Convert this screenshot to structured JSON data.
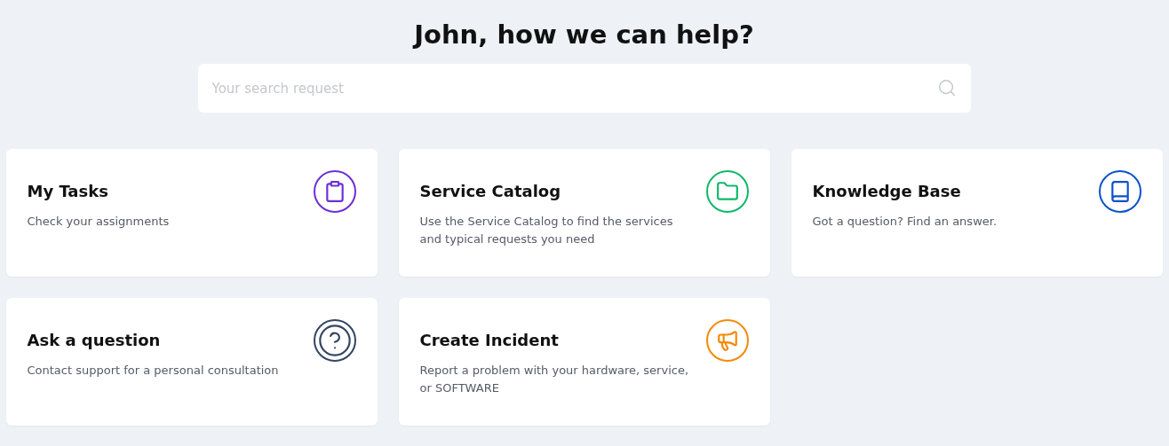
{
  "heading": "John, how we can help?",
  "search": {
    "placeholder": "Your search request"
  },
  "cards": [
    {
      "title": "My Tasks",
      "description": "Check your assignments",
      "kind": "clipboard",
      "color": "#6d2fd6"
    },
    {
      "title": "Service Catalog",
      "description": "Use the Service Catalog to find the services and typical requests you need",
      "kind": "folder",
      "color": "#12b76a"
    },
    {
      "title": "Knowledge Base",
      "description": "Got a question? Find an answer.",
      "kind": "book",
      "color": "#0b52c9"
    },
    {
      "title": "Ask a question",
      "description": "Contact support for a personal consultation",
      "kind": "question",
      "color": "#334563"
    },
    {
      "title": "Create Incident",
      "description": "Report a problem with your hardware, service, or SOFTWARE",
      "kind": "megaphone",
      "color": "#f58a07"
    }
  ]
}
